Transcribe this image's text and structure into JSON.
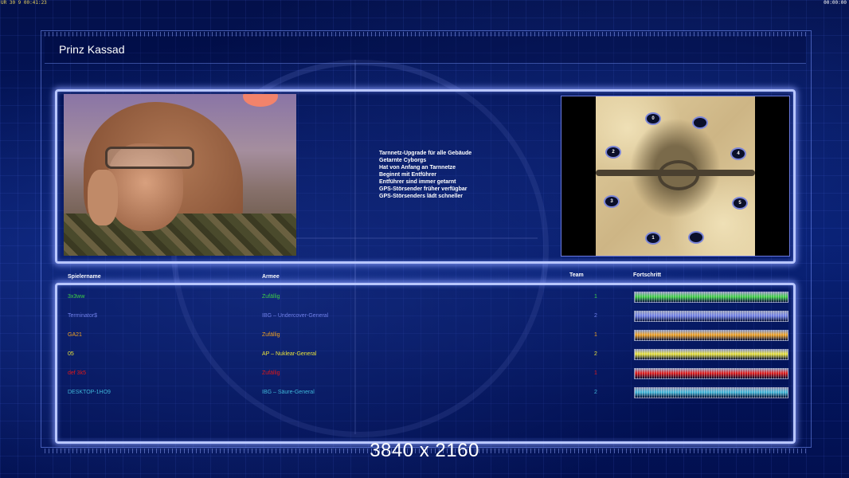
{
  "hud": {
    "left": "UR 30 9 00:41:23",
    "right": "00:00:00"
  },
  "title": "Prinz Kassad",
  "general": {
    "traits": [
      "Tarnnetz-Upgrade für alle Gebäude",
      "Getarnte Cyborgs",
      "Hat von Anfang an Tarnnetze",
      "Beginnt mit Entführer",
      "Entführer sind immer getarnt",
      "GPS-Störsender früher verfügbar",
      "GPS-Störsenders lädt schneller"
    ]
  },
  "map": {
    "spots": [
      "0",
      "",
      "2",
      "4",
      "3",
      "5",
      "1",
      ""
    ]
  },
  "table": {
    "headers": {
      "player": "Spielername",
      "army": "Armee",
      "team": "Team",
      "progress": "Fortschritt"
    },
    "rows": [
      {
        "player": "3x3ww",
        "army": "Zufällig",
        "team": "1",
        "color": "#3ecf45",
        "progress": 1.0
      },
      {
        "player": "Terminator$",
        "army": "IBG – Undercover-General",
        "team": "2",
        "color": "#6f7fe8",
        "progress": 1.0
      },
      {
        "player": "GA21",
        "army": "Zufällig",
        "team": "1",
        "color": "#f0a020",
        "progress": 1.0
      },
      {
        "player": "05",
        "army": "AP – Nuklear-General",
        "team": "2",
        "color": "#e8e23a",
        "progress": 1.0
      },
      {
        "player": "def 3k5",
        "army": "Zufällig",
        "team": "1",
        "color": "#e01818",
        "progress": 1.0
      },
      {
        "player": "DESKTOP-1HO9",
        "army": "IBG – Säure-General",
        "team": "2",
        "color": "#3fb6d8",
        "progress": 1.0
      }
    ]
  },
  "watermark": "3840 x 2160"
}
